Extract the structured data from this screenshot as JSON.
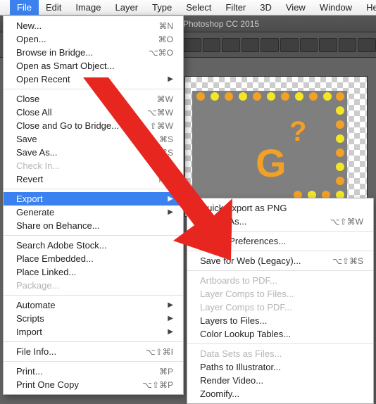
{
  "menubar": {
    "items": [
      "File",
      "Edit",
      "Image",
      "Layer",
      "Type",
      "Select",
      "Filter",
      "3D",
      "View",
      "Window",
      "He"
    ],
    "activeIndex": 0
  },
  "app": {
    "title": "Photoshop CC 2015"
  },
  "canvas": {
    "question": "?",
    "bigText": "G"
  },
  "fileMenu": [
    {
      "label": "New...",
      "shortcut": "⌘N"
    },
    {
      "label": "Open...",
      "shortcut": "⌘O"
    },
    {
      "label": "Browse in Bridge...",
      "shortcut": "⌥⌘O"
    },
    {
      "label": "Open as Smart Object..."
    },
    {
      "label": "Open Recent",
      "submenu": true
    },
    {
      "sep": true
    },
    {
      "label": "Close",
      "shortcut": "⌘W"
    },
    {
      "label": "Close All",
      "shortcut": "⌥⌘W"
    },
    {
      "label": "Close and Go to Bridge...",
      "shortcut": "⇧⌘W"
    },
    {
      "label": "Save",
      "shortcut": "⌘S"
    },
    {
      "label": "Save As...",
      "shortcut": "⇧⌘S"
    },
    {
      "label": "Check In...",
      "disabled": true
    },
    {
      "label": "Revert",
      "shortcut": "F12"
    },
    {
      "sep": true
    },
    {
      "label": "Export",
      "submenu": true,
      "hl": true
    },
    {
      "label": "Generate",
      "submenu": true
    },
    {
      "label": "Share on Behance..."
    },
    {
      "sep": true
    },
    {
      "label": "Search Adobe Stock..."
    },
    {
      "label": "Place Embedded..."
    },
    {
      "label": "Place Linked..."
    },
    {
      "label": "Package...",
      "disabled": true
    },
    {
      "sep": true
    },
    {
      "label": "Automate",
      "submenu": true
    },
    {
      "label": "Scripts",
      "submenu": true
    },
    {
      "label": "Import",
      "submenu": true
    },
    {
      "sep": true
    },
    {
      "label": "File Info...",
      "shortcut": "⌥⇧⌘I"
    },
    {
      "sep": true
    },
    {
      "label": "Print...",
      "shortcut": "⌘P"
    },
    {
      "label": "Print One Copy",
      "shortcut": "⌥⇧⌘P"
    }
  ],
  "exportMenu": [
    {
      "label": "Quick Export as PNG"
    },
    {
      "label": "Export As...",
      "shortcut": "⌥⇧⌘W"
    },
    {
      "sep": true
    },
    {
      "label": "Export Preferences..."
    },
    {
      "sep": true
    },
    {
      "label": "Save for Web (Legacy)...",
      "shortcut": "⌥⇧⌘S"
    },
    {
      "sep": true
    },
    {
      "label": "Artboards to PDF...",
      "disabled": true
    },
    {
      "label": "Layer Comps to Files...",
      "disabled": true
    },
    {
      "label": "Layer Comps to PDF...",
      "disabled": true
    },
    {
      "label": "Layers to Files..."
    },
    {
      "label": "Color Lookup Tables..."
    },
    {
      "sep": true
    },
    {
      "label": "Data Sets as Files...",
      "disabled": true
    },
    {
      "label": "Paths to Illustrator..."
    },
    {
      "label": "Render Video..."
    },
    {
      "label": "Zoomify..."
    }
  ]
}
